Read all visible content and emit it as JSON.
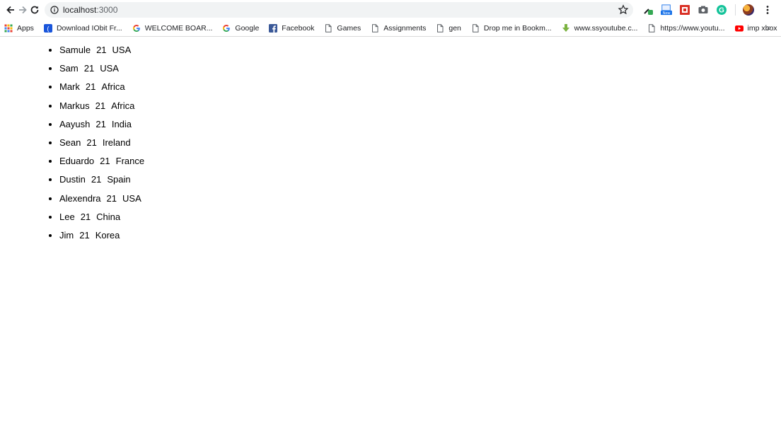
{
  "browser": {
    "url_host": "localhost",
    "url_port": ":3000",
    "extensions": [
      {
        "icon": "eyedropper-icon",
        "color": "#34a853"
      },
      {
        "icon": "new-badge-extension-icon",
        "badge": "New",
        "color": "#1a73e8"
      },
      {
        "icon": "red-square-extension-icon",
        "color": "#d93025"
      },
      {
        "icon": "camera-icon",
        "color": "#5f6368"
      },
      {
        "icon": "grammarly-icon",
        "color": "#15c39a"
      }
    ]
  },
  "bookmarks": {
    "items": [
      {
        "label": "Apps",
        "icon": "apps-grid-icon"
      },
      {
        "label": "Download IObit Fr...",
        "icon": "iobit-icon"
      },
      {
        "label": "WELCOME BOAR...",
        "icon": "google-icon"
      },
      {
        "label": "Google",
        "icon": "google-icon"
      },
      {
        "label": "Facebook",
        "icon": "facebook-icon"
      },
      {
        "label": "Games",
        "icon": "page-icon"
      },
      {
        "label": "Assignments",
        "icon": "page-icon"
      },
      {
        "label": "gen",
        "icon": "page-icon"
      },
      {
        "label": "Drop me in Bookm...",
        "icon": "page-icon"
      },
      {
        "label": "www.ssyoutube.c...",
        "icon": "download-arrow-icon"
      },
      {
        "label": "https://www.youtu...",
        "icon": "page-icon"
      },
      {
        "label": "imp xbox",
        "icon": "youtube-icon"
      }
    ],
    "more": "»"
  },
  "people": [
    {
      "name": "Samule",
      "age": "21",
      "country": "USA"
    },
    {
      "name": "Sam",
      "age": "21",
      "country": "USA"
    },
    {
      "name": "Mark",
      "age": "21",
      "country": "Africa"
    },
    {
      "name": "Markus",
      "age": "21",
      "country": "Africa"
    },
    {
      "name": "Aayush",
      "age": "21",
      "country": "India"
    },
    {
      "name": "Sean",
      "age": "21",
      "country": "Ireland"
    },
    {
      "name": "Eduardo",
      "age": "21",
      "country": "France"
    },
    {
      "name": "Dustin",
      "age": "21",
      "country": "Spain"
    },
    {
      "name": "Alexendra",
      "age": "21",
      "country": "USA"
    },
    {
      "name": "Lee",
      "age": "21",
      "country": "China"
    },
    {
      "name": "Jim",
      "age": "21",
      "country": "Korea"
    }
  ]
}
